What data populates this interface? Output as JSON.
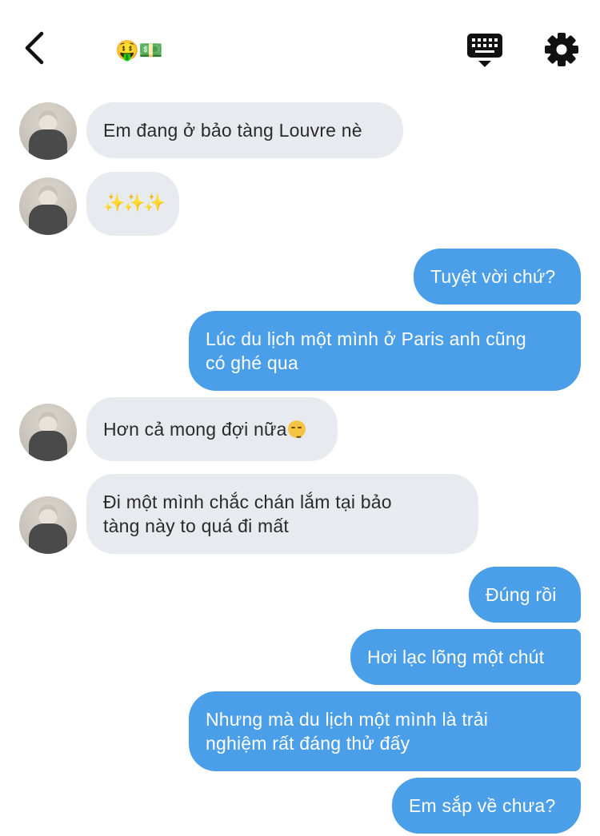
{
  "header": {
    "title_emoji": "🤑💵",
    "back_icon": "chevron-left-icon",
    "keyboard_icon": "keyboard-icon",
    "settings_icon": "gear-icon"
  },
  "colors": {
    "incoming_bubble": "#e7ebef",
    "outgoing_bubble": "#4b9ee8",
    "outgoing_text": "#ffffff",
    "incoming_text": "#2a2a2a"
  },
  "messages": [
    {
      "sender": "them",
      "text": "Em đang ở bảo tàng Louvre nè"
    },
    {
      "sender": "them",
      "text": "✨✨✨"
    },
    {
      "sender": "me",
      "text": "Tuyệt vời chứ?"
    },
    {
      "sender": "me",
      "text": "Lúc du lịch một mình ở Paris anh cũng\ncó ghé qua"
    },
    {
      "sender": "them",
      "text": "Hơn cả mong đợi nữa"
    },
    {
      "sender": "them",
      "text": "Đi một mình chắc chán lắm tại bảo\ntàng này to quá đi mất"
    },
    {
      "sender": "me",
      "text": "Đúng rồi"
    },
    {
      "sender": "me",
      "text": "Hơi lạc lõng một chút"
    },
    {
      "sender": "me",
      "text": "Nhưng mà du lịch một mình là trải\nnghiệm rất đáng thử đấy"
    },
    {
      "sender": "me",
      "text": "Em sắp về chưa?"
    }
  ]
}
